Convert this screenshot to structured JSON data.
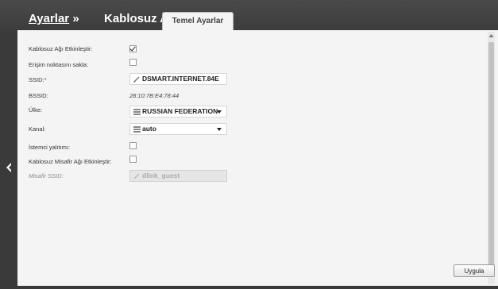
{
  "header": {
    "breadcrumb_1": "Ayarlar",
    "breadcrumb_sep_1": " »",
    "breadcrumb_2": "Kablosuz Ağ »",
    "tab_label": "Temel Ayarlar"
  },
  "form": {
    "enable_wireless": {
      "label": "Kablosuz Ağı Etkinleştir:",
      "checked": true
    },
    "hide_ap": {
      "label": "Erişim noktasını sakla:",
      "checked": false
    },
    "ssid": {
      "label": "SSID:",
      "required_mark": "*",
      "value": "DSMART.INTERNET.84E",
      "icon": "edit-pencil-icon"
    },
    "bssid": {
      "label": "BSSID:",
      "value": "28:10:7B:E4:78:44"
    },
    "country": {
      "label": "Ülke:",
      "value": "RUSSIAN FEDERATION",
      "icon": "list-icon"
    },
    "channel": {
      "label": "Kanal:",
      "value": "auto",
      "icon": "list-icon"
    },
    "client_isolation": {
      "label": "İstemci yalıtımı:",
      "checked": false
    },
    "enable_guest": {
      "label": "Kablosuz Misafir Ağı Etkinleştir:",
      "checked": false
    },
    "guest_ssid": {
      "label": "Misafir SSID:",
      "value": "dlink_guest",
      "disabled": true
    }
  },
  "footer": {
    "apply_label": "Uygula"
  },
  "colors": {
    "background": "#3a3a3a",
    "panel": "#f4f4f4",
    "required": "#d21e1e"
  }
}
